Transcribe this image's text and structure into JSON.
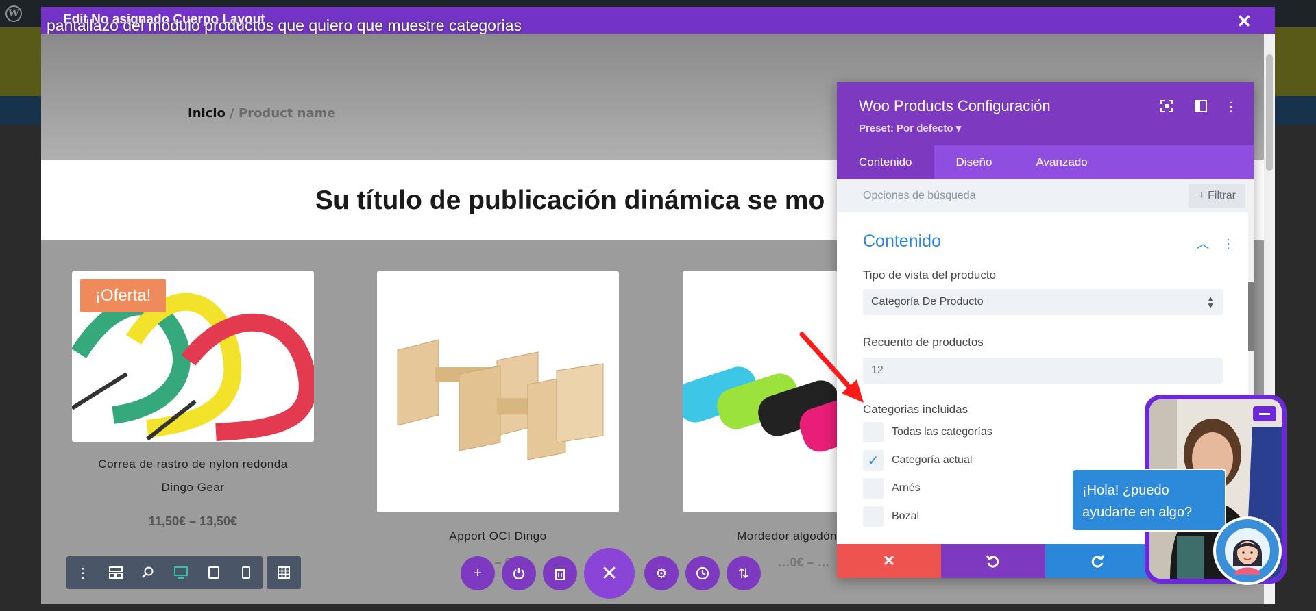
{
  "modal": {
    "title": "Edit No asignado Cuerpo Layout",
    "caption": "pantallazo del módulo productos que quiero que muestre categorias",
    "close": "✕"
  },
  "page": {
    "breadcrumb_home": "Inicio",
    "breadcrumb_sep": " / ",
    "breadcrumb_current": "Product name",
    "post_title": "Su título de publicación dinámica se mo",
    "products": [
      {
        "name_line1": "Correa de rastro de nylon redonda",
        "name_line2": "Dingo Gear",
        "price": "11,50€ – 13,50€",
        "badge": "¡Oferta!"
      },
      {
        "name_line1": "Apport OCI Dingo",
        "name_line2": "",
        "price": "5,… – 6,…"
      },
      {
        "name_line1": "Mordedor algodón sintét",
        "name_line2": "",
        "price": "…0€ – …"
      }
    ]
  },
  "panel": {
    "title": "Woo Products Configuración",
    "preset": "Preset: Por defecto ▾",
    "tabs": [
      "Contenido",
      "Diseño",
      "Avanzado"
    ],
    "search_placeholder": "Opciones de búsqueda",
    "filter_label": "+ Filtrar",
    "section_title": "Contenido",
    "view_type_label": "Tipo de vista del producto",
    "view_type_value": "Categoría De Producto",
    "count_label": "Recuento de productos",
    "count_value": "12",
    "categories_label": "Categorias incluidas",
    "categories": [
      {
        "label": "Todas las categorías",
        "checked": false
      },
      {
        "label": "Categoría actual",
        "checked": true
      },
      {
        "label": "Arnés",
        "checked": false
      },
      {
        "label": "Bozal",
        "checked": false
      }
    ]
  },
  "chat": {
    "greeting": "¡Hola! ¿puedo ayudarte en algo?"
  },
  "colors": {
    "purple": "#7d3ac1",
    "blue": "#2b87da",
    "red": "#ef5350",
    "green": "#29c4a9"
  }
}
